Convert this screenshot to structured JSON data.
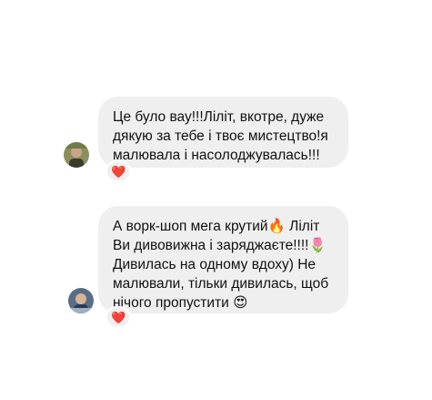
{
  "colors": {
    "bubble_bg": "#efefef",
    "text": "#111111",
    "reaction_heart": "#e0245e"
  },
  "messages": [
    {
      "avatar_icon": "profile-photo",
      "lines": [
        "Це було вау!!!Ліліт, вкотре, дуже",
        "дякую за тебе і твоє мистецтво!я",
        "малювала і насолоджувалась!!!"
      ],
      "reaction": "❤️"
    },
    {
      "avatar_icon": "profile-photo",
      "lines": [
        "А ворк-шоп мега крутий🔥 Ліліт",
        "Ви дивовижна і заряджаєте!!!!🌷",
        "Дивилась на одному вдоху) Не",
        "малювали, тільки дивилась, щоб",
        "нічого пропустити 😍"
      ],
      "reaction": "❤️"
    }
  ]
}
